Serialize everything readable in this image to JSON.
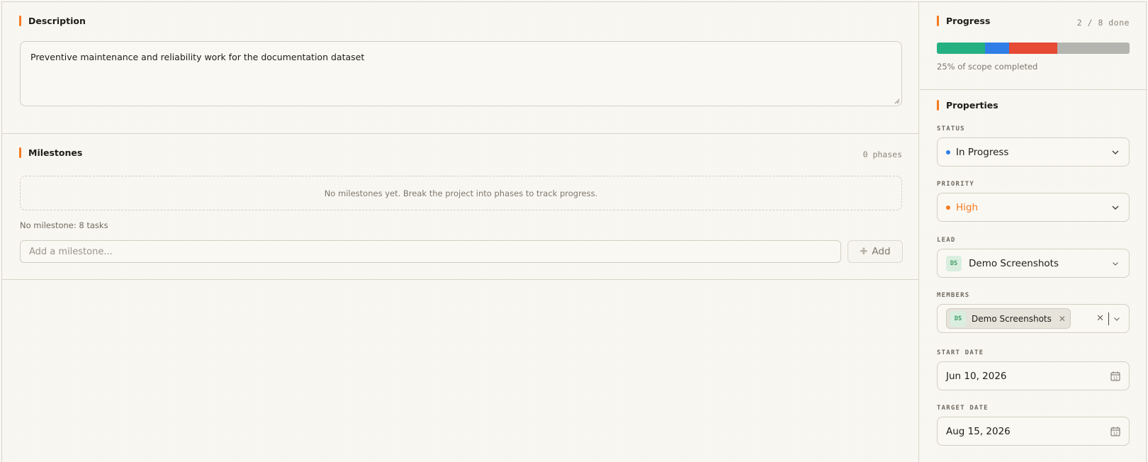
{
  "description": {
    "title": "Description",
    "text": "Preventive maintenance and reliability work for the documentation dataset"
  },
  "milestones": {
    "title": "Milestones",
    "phase_count": "0 phases",
    "empty_text": "No milestones yet. Break the project into phases to track progress.",
    "no_milestone_text": "No milestone: 8 tasks",
    "input_placeholder": "Add a milestone...",
    "add_label": "Add"
  },
  "progress": {
    "title": "Progress",
    "done_count": "2 / 8 done",
    "caption": "25% of scope completed",
    "segments": [
      {
        "status": "done",
        "fraction": 0.25,
        "color": "#25b082"
      },
      {
        "status": "in-progress",
        "fraction": 0.125,
        "color": "#2f7ee8"
      },
      {
        "status": "blocked",
        "fraction": 0.25,
        "color": "#e64a34"
      },
      {
        "status": "todo",
        "fraction": 0.375,
        "color": "#b4b5b1"
      }
    ]
  },
  "properties": {
    "title": "Properties",
    "status": {
      "label": "STATUS",
      "value": "In Progress",
      "color": "#2f7ee8"
    },
    "priority": {
      "label": "PRIORITY",
      "value": "High",
      "color": "#f47a20"
    },
    "lead": {
      "label": "LEAD",
      "initials": "DS",
      "value": "Demo Screenshots"
    },
    "members": {
      "label": "MEMBERS",
      "items": [
        {
          "initials": "DS",
          "name": "Demo Screenshots"
        }
      ]
    },
    "start_date": {
      "label": "START DATE",
      "value": "Jun 10, 2026",
      "icon_day": "12"
    },
    "target_date": {
      "label": "TARGET DATE",
      "value": "Aug 15, 2026",
      "icon_day": "12"
    }
  },
  "colors": {
    "accent": "#f47a20"
  }
}
